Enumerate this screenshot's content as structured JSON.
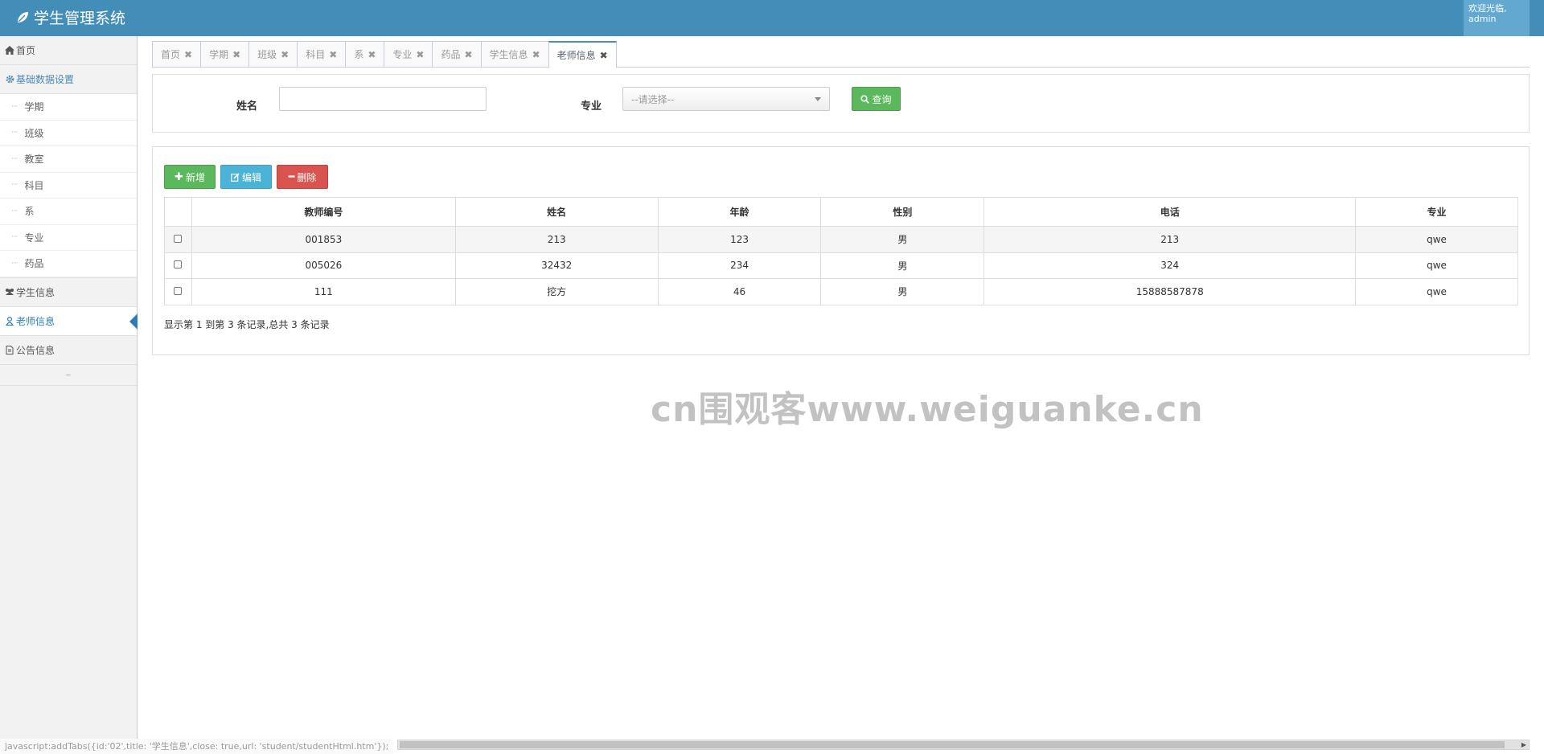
{
  "app": {
    "title": "学生管理系统",
    "welcome_line1": "欢迎光临,",
    "welcome_line2": "admin"
  },
  "sidebar": {
    "home": "首页",
    "basic_settings": "基础数据设置",
    "sub_items": [
      "学期",
      "班级",
      "教室",
      "科目",
      "系",
      "专业",
      "药品"
    ],
    "student_info": "学生信息",
    "teacher_info": "老师信息",
    "notice_info": "公告信息"
  },
  "tabs": [
    "首页",
    "学期",
    "班级",
    "科目",
    "系",
    "专业",
    "药品",
    "学生信息",
    "老师信息"
  ],
  "active_tab": "老师信息",
  "search": {
    "name_label": "姓名",
    "name_value": "",
    "major_label": "专业",
    "major_selected": "--请选择--",
    "query_label": "查询"
  },
  "toolbar": {
    "add_label": "新增",
    "edit_label": "编辑",
    "delete_label": "删除"
  },
  "table": {
    "headers": [
      "教师编号",
      "姓名",
      "年龄",
      "性别",
      "电话",
      "专业"
    ],
    "rows": [
      [
        "001853",
        "213",
        "123",
        "男",
        "213",
        "qwe"
      ],
      [
        "005026",
        "32432",
        "234",
        "男",
        "324",
        "qwe"
      ],
      [
        "111",
        "挖方",
        "46",
        "男",
        "15888587878",
        "qwe"
      ]
    ]
  },
  "pager_info": "显示第 1 到第 3 条记录,总共 3 条记录",
  "watermark": "cn围观客www.weiguanke.cn",
  "status_bar": "javascript:addTabs({id:'02',title: '学生信息',close: true,url: 'student/studentHtml.htm'});",
  "colors": {
    "header": "#438eb9",
    "success": "#5cb85c",
    "info": "#4bb4d6",
    "danger": "#d9534f",
    "active_link": "#2b7dbc"
  }
}
